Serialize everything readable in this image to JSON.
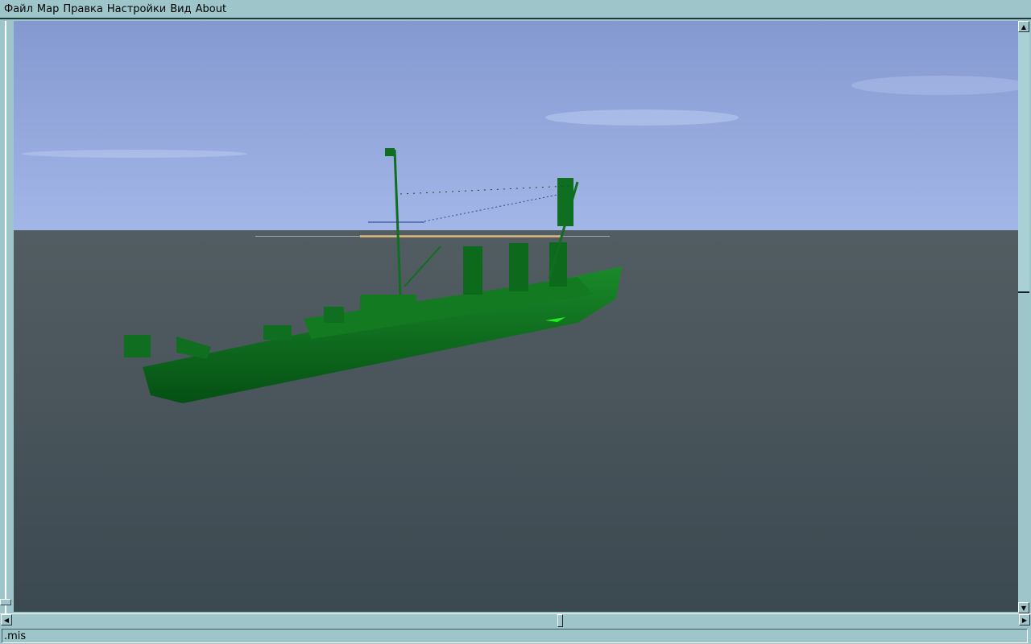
{
  "menu": [
    "Файл",
    "Мар",
    "Правка",
    "Настройки",
    "Вид",
    "About"
  ],
  "status": {
    "text": ".mis"
  },
  "scene": {
    "sky_top": "#8aa0d6",
    "sky_bottom": "#a4b8e8",
    "sea_top": "#4a5a62",
    "sea_bottom": "#3c4a50",
    "ship_color": "#0a6a1c"
  }
}
